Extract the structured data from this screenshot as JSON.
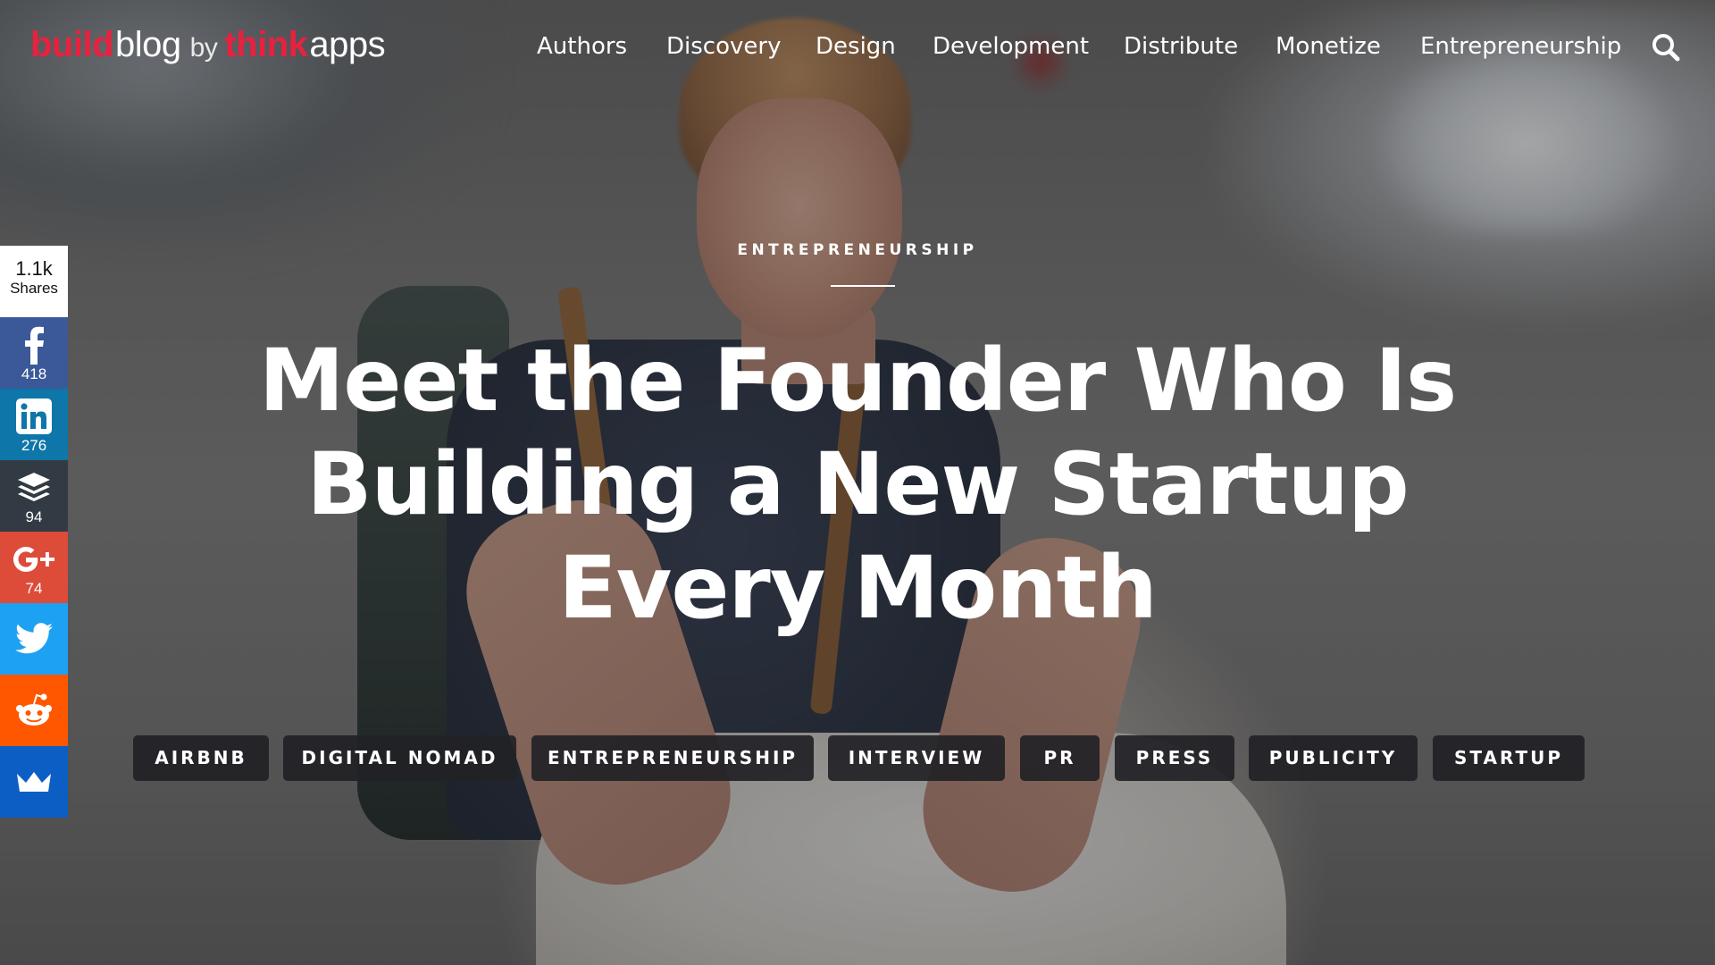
{
  "logo": {
    "build": "build",
    "blog": "blog",
    "by": "by",
    "think": "think",
    "apps": "apps",
    "brand_color": "#e8213f"
  },
  "nav": {
    "items": [
      {
        "label": "Authors"
      },
      {
        "label": "Discovery"
      },
      {
        "label": "Design"
      },
      {
        "label": "Development"
      },
      {
        "label": "Distribute"
      },
      {
        "label": "Monetize"
      },
      {
        "label": "Entrepreneurship"
      }
    ],
    "search_icon": "search-icon"
  },
  "share": {
    "total": "1.1k",
    "total_label": "Shares",
    "buttons": [
      {
        "network": "facebook",
        "icon": "facebook-icon",
        "count": "418",
        "color": "#3b5998"
      },
      {
        "network": "linkedin",
        "icon": "linkedin-icon",
        "count": "276",
        "color": "#0e76a8"
      },
      {
        "network": "buffer",
        "icon": "buffer-icon",
        "count": "94",
        "color": "#323b43"
      },
      {
        "network": "google-plus",
        "icon": "google-plus-icon",
        "count": "74",
        "color": "#dd4b39"
      },
      {
        "network": "twitter",
        "icon": "twitter-icon",
        "count": "",
        "color": "#1da1f2"
      },
      {
        "network": "reddit",
        "icon": "reddit-icon",
        "count": "",
        "color": "#ff5700"
      },
      {
        "network": "sumome",
        "icon": "crown-icon",
        "count": "",
        "color": "#0b5fc4"
      }
    ]
  },
  "hero": {
    "category": "ENTREPRENEURSHIP",
    "title": "Meet the Founder Who Is Building a New Startup Every Month"
  },
  "tags": [
    {
      "label": "AIRBNB"
    },
    {
      "label": "DIGITAL NOMAD"
    },
    {
      "label": "ENTREPRENEURSHIP"
    },
    {
      "label": "INTERVIEW"
    },
    {
      "label": "PR"
    },
    {
      "label": "PRESS"
    },
    {
      "label": "PUBLICITY"
    },
    {
      "label": "STARTUP"
    }
  ]
}
